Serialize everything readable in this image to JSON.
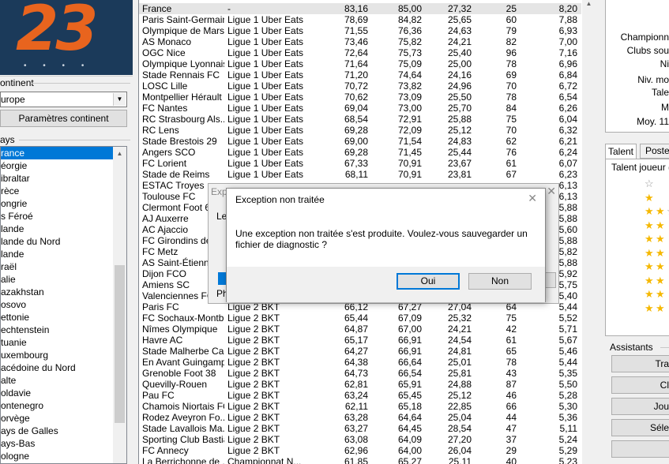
{
  "logo": {
    "text": "23",
    "dots": "• • • •"
  },
  "continent": {
    "label": "ontinent",
    "value": "urope",
    "button": "Paramètres continent"
  },
  "pays": {
    "label": "ays",
    "items": [
      "rance",
      "éorgie",
      "ibraltar",
      "rèce",
      "ongrie",
      "s Féroé",
      "lande",
      "lande du Nord",
      "lande",
      "raël",
      "alie",
      "azakhstan",
      "osovo",
      "ettonie",
      "echtenstein",
      "tuanie",
      "uxembourg",
      "acédoine du Nord",
      "alte",
      "oldavie",
      "ontenegro",
      "orvège",
      "ays de Galles",
      "ays-Bas",
      "ologne"
    ]
  },
  "table": {
    "rows": [
      [
        "France",
        "-",
        "83,16",
        "85,00",
        "27,32",
        "25",
        "8,20"
      ],
      [
        "Paris Saint-Germain",
        "Ligue 1 Uber Eats",
        "78,69",
        "84,82",
        "25,65",
        "60",
        "7,88"
      ],
      [
        "Olympique de Mars...",
        "Ligue 1 Uber Eats",
        "71,55",
        "76,36",
        "24,63",
        "79",
        "6,93"
      ],
      [
        "AS Monaco",
        "Ligue 1 Uber Eats",
        "73,46",
        "75,82",
        "24,21",
        "82",
        "7,00"
      ],
      [
        "OGC Nice",
        "Ligue 1 Uber Eats",
        "72,64",
        "75,73",
        "25,40",
        "96",
        "7,16"
      ],
      [
        "Olympique Lyonnais",
        "Ligue 1 Uber Eats",
        "71,64",
        "75,09",
        "25,00",
        "78",
        "6,96"
      ],
      [
        "Stade Rennais FC",
        "Ligue 1 Uber Eats",
        "71,20",
        "74,64",
        "24,16",
        "69",
        "6,84"
      ],
      [
        "LOSC Lille",
        "Ligue 1 Uber Eats",
        "70,72",
        "73,82",
        "24,96",
        "70",
        "6,72"
      ],
      [
        "Montpellier Hérault ...",
        "Ligue 1 Uber Eats",
        "70,62",
        "73,09",
        "25,50",
        "78",
        "6,54"
      ],
      [
        "FC Nantes",
        "Ligue 1 Uber Eats",
        "69,04",
        "73,00",
        "25,70",
        "84",
        "6,26"
      ],
      [
        "RC Strasbourg Als...",
        "Ligue 1 Uber Eats",
        "68,54",
        "72,91",
        "25,88",
        "75",
        "6,04"
      ],
      [
        "RC Lens",
        "Ligue 1 Uber Eats",
        "69,28",
        "72,09",
        "25,12",
        "70",
        "6,32"
      ],
      [
        "Stade Brestois 29",
        "Ligue 1 Uber Eats",
        "69,00",
        "71,54",
        "24,83",
        "62",
        "6,21"
      ],
      [
        "Angers SCO",
        "Ligue 1 Uber Eats",
        "69,28",
        "71,45",
        "25,44",
        "76",
        "6,24"
      ],
      [
        "FC Lorient",
        "Ligue 1 Uber Eats",
        "67,33",
        "70,91",
        "23,67",
        "61",
        "6,07"
      ],
      [
        "Stade de Reims",
        "Ligue 1 Uber Eats",
        "68,11",
        "70,91",
        "23,81",
        "67",
        "6,23"
      ],
      [
        "ESTAC Troyes",
        "",
        "",
        "",
        "",
        "",
        "6,13"
      ],
      [
        "Toulouse FC",
        "",
        "",
        "",
        "",
        "",
        "6,13"
      ],
      [
        "Clermont Foot 63",
        "",
        "",
        "",
        "",
        "",
        "5,88"
      ],
      [
        "AJ Auxerre",
        "",
        "",
        "",
        "",
        "",
        "5,88"
      ],
      [
        "AC Ajaccio",
        "",
        "",
        "",
        "",
        "",
        "5,60"
      ],
      [
        "FC Girondins de B...",
        "",
        "",
        "",
        "",
        "",
        "5,88"
      ],
      [
        "FC Metz",
        "",
        "",
        "",
        "",
        "",
        "5,82"
      ],
      [
        "AS Saint-Étienne",
        "",
        "",
        "",
        "",
        "",
        "5,88"
      ],
      [
        "Dijon FCO",
        "",
        "",
        "",
        "",
        "",
        "5,92"
      ],
      [
        "Amiens SC",
        "",
        "",
        "",
        "",
        "",
        "5,75"
      ],
      [
        "Valenciennes FC",
        "",
        "",
        "",
        "",
        "",
        "5,40"
      ],
      [
        "Paris FC",
        "Ligue 2 BKT",
        "66,12",
        "67,27",
        "27,04",
        "64",
        "5,44"
      ],
      [
        "FC Sochaux-Montb...",
        "Ligue 2 BKT",
        "65,44",
        "67,09",
        "25,32",
        "75",
        "5,52"
      ],
      [
        "Nîmes Olympique",
        "Ligue 2 BKT",
        "64,87",
        "67,00",
        "24,21",
        "42",
        "5,71"
      ],
      [
        "Havre AC",
        "Ligue 2 BKT",
        "65,17",
        "66,91",
        "24,54",
        "61",
        "5,67"
      ],
      [
        "Stade Malherbe Ca...",
        "Ligue 2 BKT",
        "64,27",
        "66,91",
        "24,81",
        "65",
        "5,46"
      ],
      [
        "En Avant Guingamp",
        "Ligue 2 BKT",
        "64,38",
        "66,64",
        "25,01",
        "78",
        "5,44"
      ],
      [
        "Grenoble Foot 38",
        "Ligue 2 BKT",
        "64,73",
        "66,54",
        "25,81",
        "43",
        "5,35"
      ],
      [
        "Quevilly-Rouen",
        "Ligue 2 BKT",
        "62,81",
        "65,91",
        "24,88",
        "87",
        "5,50"
      ],
      [
        "Pau FC",
        "Ligue 2 BKT",
        "63,24",
        "65,45",
        "25,12",
        "46",
        "5,28"
      ],
      [
        "Chamois Niortais FC",
        "Ligue 2 BKT",
        "62,11",
        "65,18",
        "22,85",
        "66",
        "5,30"
      ],
      [
        "Rodez Aveyron Fo...",
        "Ligue 2 BKT",
        "63,28",
        "64,64",
        "25,04",
        "44",
        "5,36"
      ],
      [
        "Stade Lavallois Ma...",
        "Ligue 2 BKT",
        "63,27",
        "64,45",
        "28,54",
        "47",
        "5,11"
      ],
      [
        "Sporting Club Bastia",
        "Ligue 2 BKT",
        "63,08",
        "64,09",
        "27,20",
        "37",
        "5,24"
      ],
      [
        "FC Annecy",
        "Ligue 2 BKT",
        "62,96",
        "64,00",
        "26,04",
        "29",
        "5,29"
      ],
      [
        "La Berrichonne de ...",
        "Championnat N...",
        "61,85",
        "65,27",
        "25,11",
        "40",
        "5,23"
      ]
    ]
  },
  "right": {
    "info_labels": [
      "Championn",
      "Clubs sou",
      "Ni",
      "Niv. mo",
      "Tale",
      "M",
      "Moy. 11"
    ],
    "tabs": [
      "Talent",
      "Postes"
    ],
    "talent_label": "Talent joueur (F",
    "assistants_label": "Assistants",
    "assistant_buttons": [
      "Tra",
      "Cl",
      "Jou",
      "Séle",
      ""
    ]
  },
  "bg_dialog": {
    "title": "Exp",
    "text_l": "Le",
    "text_ph": "Ph"
  },
  "dialog": {
    "title": "Exception non traitée",
    "message": "Une exception non traitée s'est produite. Voulez-vous sauvegarder un fichier de diagnostic ?",
    "yes": "Oui",
    "no": "Non"
  },
  "colors": {
    "selection": "#0078d7",
    "star": "#f5b800",
    "logo_bg": "#1b3a5a",
    "logo_num": "#e8641e"
  }
}
